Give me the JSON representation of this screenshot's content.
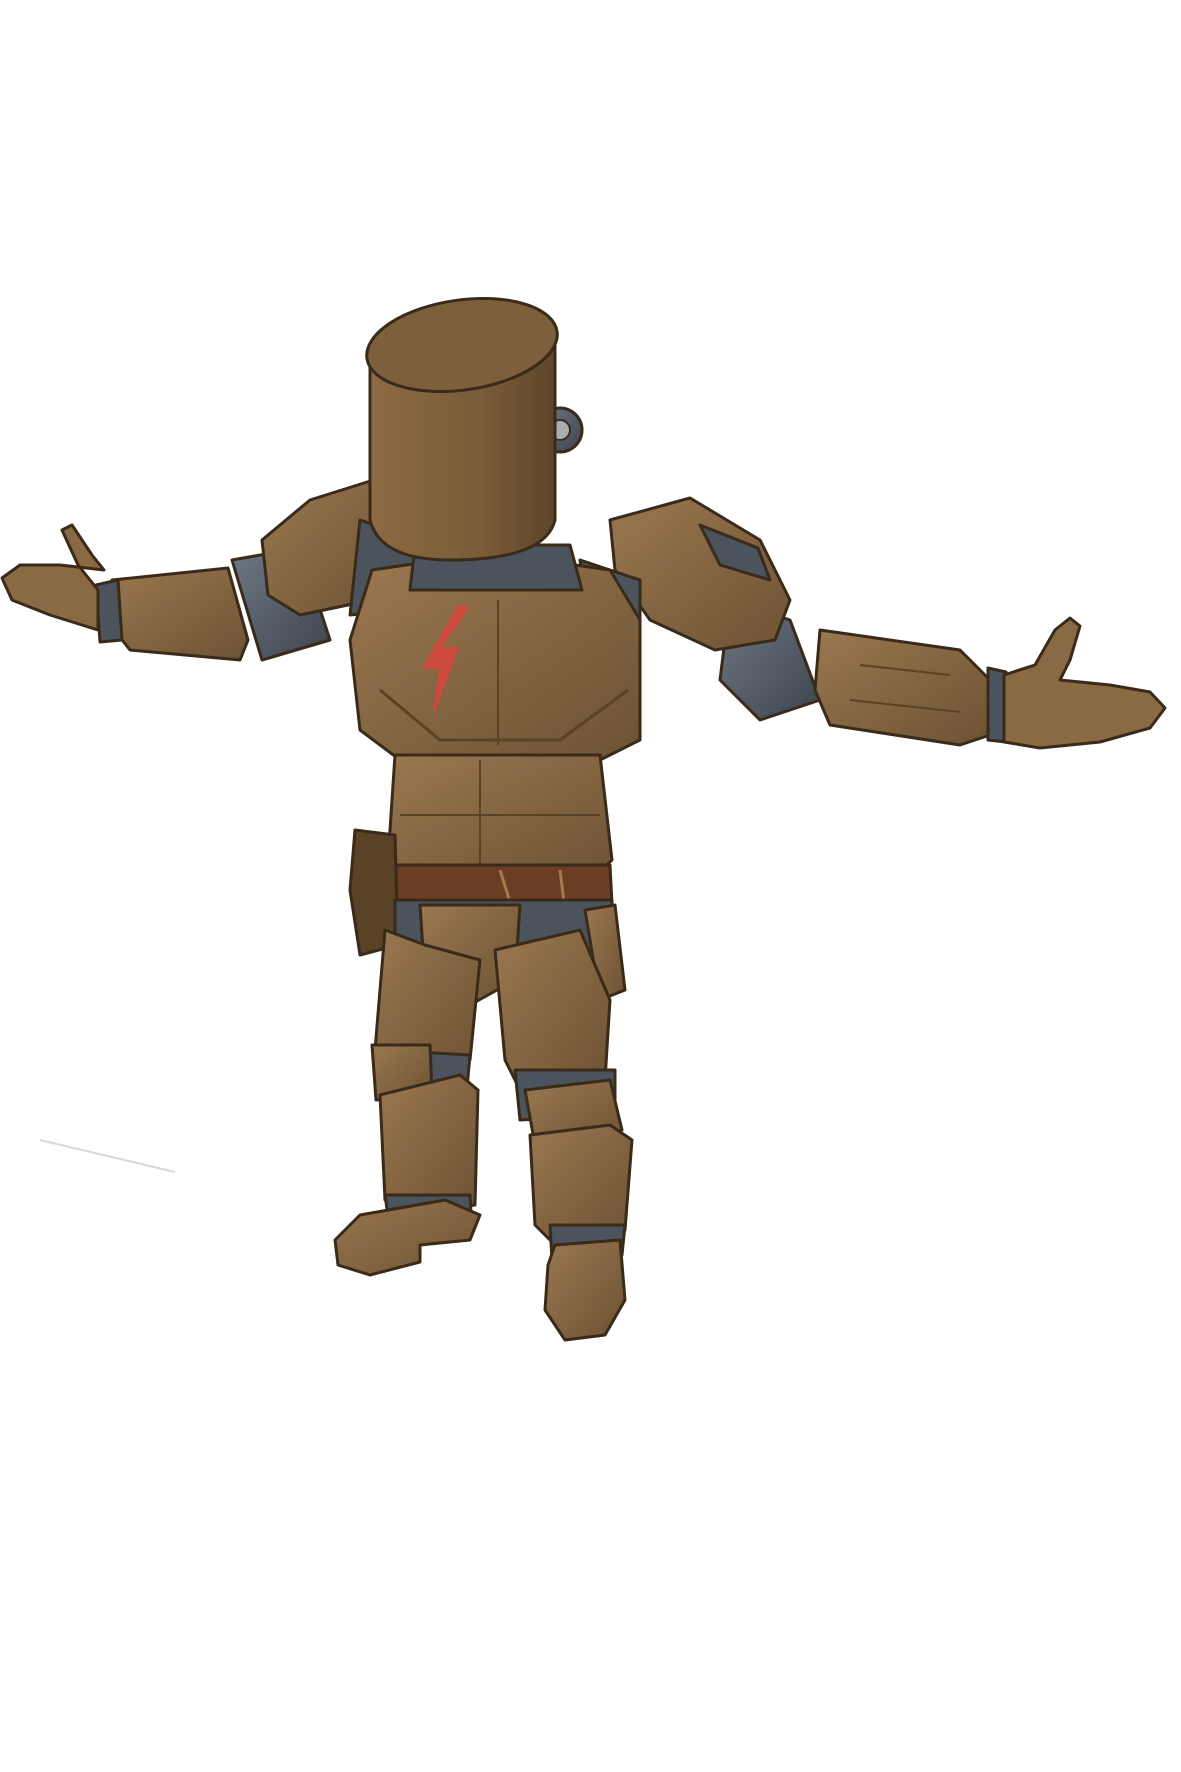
{
  "image": {
    "subject": "armored-robot-figure",
    "pose": "t-pose",
    "background": "#ffffff",
    "colors": {
      "armor": "#7d5f3c",
      "armor_light": "#957349",
      "armor_dark": "#5a4227",
      "joints": "#4b535d",
      "joints_light": "#6b7683",
      "belt": "#6b3d22",
      "emblem": "#cc4b3e",
      "outline": "#3a2a19"
    },
    "icons": {
      "chest_emblem": "lightning-bolt-icon"
    }
  }
}
